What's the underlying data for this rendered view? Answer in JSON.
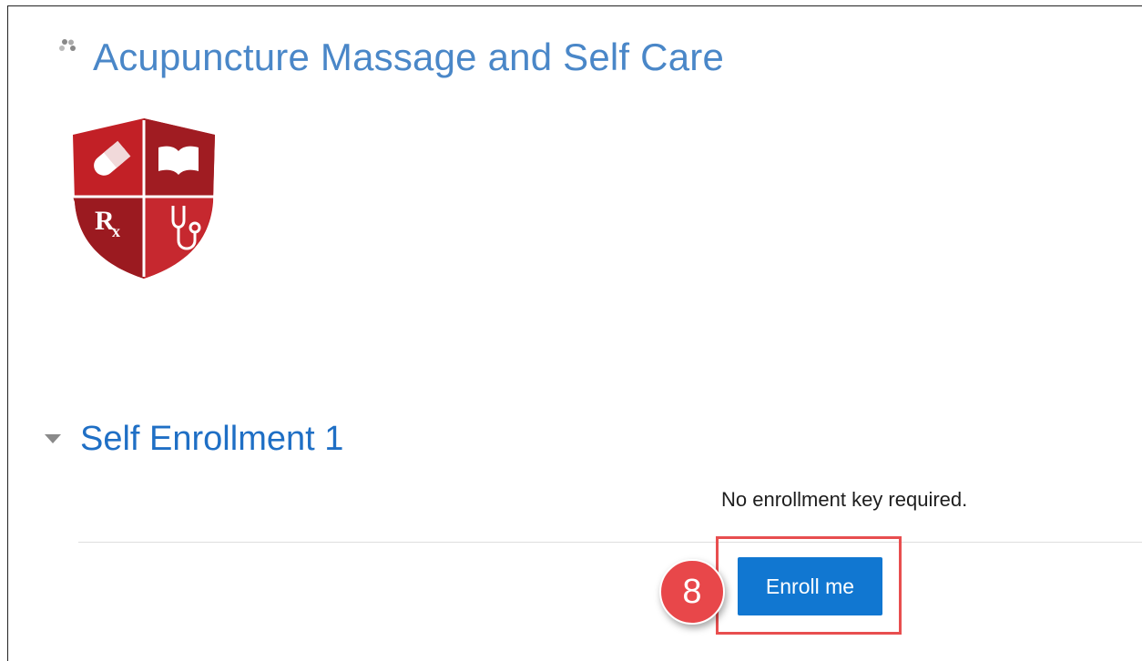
{
  "course": {
    "title": "Acupuncture Massage and Self Care",
    "icon": "course-icon",
    "image": "course-image"
  },
  "section": {
    "title": "Self Enrollment 1",
    "caret_icon": "caret-down-icon",
    "note": "No enrollment key required."
  },
  "enroll_button": {
    "label": "Enroll me"
  },
  "annotation": {
    "step": "8",
    "badge_color": "#e8474a",
    "highlight_color": "#e84e4f"
  },
  "colors": {
    "title_link": "#4a87c8",
    "section_title": "#1f6fc5",
    "primary_button": "#1177d1",
    "shield_red": "#b51f26"
  }
}
